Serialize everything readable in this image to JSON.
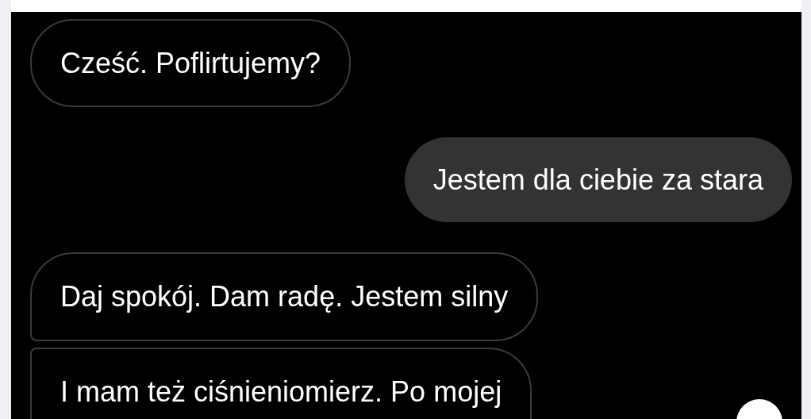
{
  "messages": [
    {
      "kind": "received",
      "text": "Cześć. Poflirtujemy?"
    },
    {
      "kind": "sent",
      "text": "Jestem dla ciebie za stara"
    },
    {
      "kind": "received",
      "text": "Daj spokój. Dam radę. Jestem silny"
    },
    {
      "kind": "received",
      "text": "I mam też ciśnieniomierz. Po mojej"
    }
  ]
}
